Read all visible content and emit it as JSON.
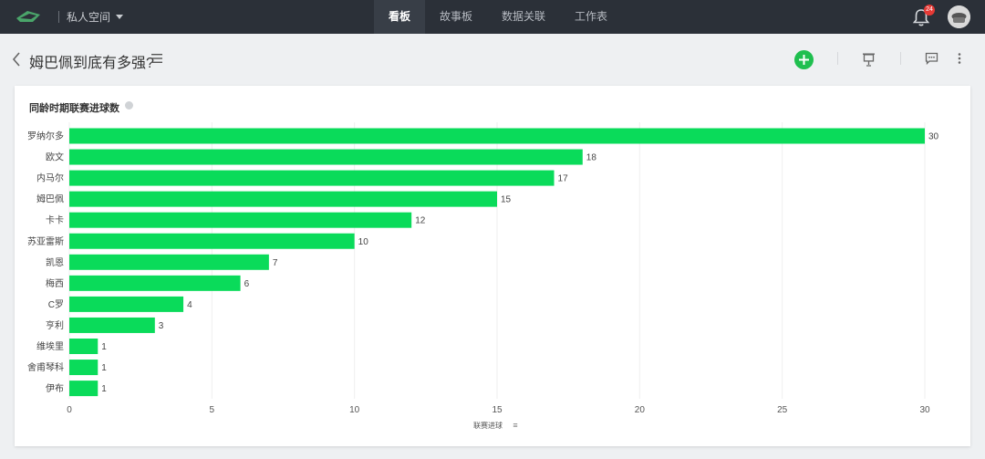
{
  "topbar": {
    "workspace": "私人空间",
    "tabs": [
      {
        "label": "看板",
        "active": true
      },
      {
        "label": "故事板",
        "active": false
      },
      {
        "label": "数据关联",
        "active": false
      },
      {
        "label": "工作表",
        "active": false
      }
    ],
    "notification_count": "24",
    "icons": {
      "logo": "logo-icon",
      "bell": "bell-icon",
      "avatar": "avatar"
    }
  },
  "header": {
    "title": "姆巴佩到底有多强?",
    "icons": [
      "back-chevron-icon",
      "menu-icon",
      "add-icon",
      "presentation-icon",
      "comment-icon",
      "more-icon"
    ]
  },
  "card": {
    "title": "同龄时期联赛进球数"
  },
  "colors": {
    "bar": "#0adb5a",
    "topbar": "#2b3038",
    "add_button": "#1fbf4f",
    "badge": "#e53935"
  },
  "chart_data": {
    "type": "bar",
    "orientation": "horizontal",
    "title": "同龄时期联赛进球数",
    "xlabel": "联赛进球",
    "xlabel_suffix": "≡",
    "categories": [
      "罗纳尔多",
      "欧文",
      "内马尔",
      "姆巴佩",
      "卡卡",
      "苏亚雷斯",
      "凯恩",
      "梅西",
      "C罗",
      "亨利",
      "维埃里",
      "舍甫琴科",
      "伊布"
    ],
    "values": [
      30,
      18,
      17,
      15,
      12,
      10,
      7,
      6,
      4,
      3,
      1,
      1,
      1
    ],
    "xticks": [
      "0",
      "5",
      "10",
      "15",
      "20",
      "25",
      "30"
    ],
    "xlim": [
      0,
      30
    ],
    "grid": true
  }
}
